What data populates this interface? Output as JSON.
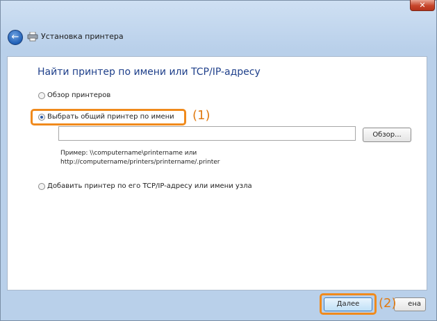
{
  "window": {
    "close_glyph": "✕",
    "title": "Установка принтера"
  },
  "page": {
    "heading": "Найти принтер по имени или TCP/IP-адресу"
  },
  "options": [
    {
      "label": "Обзор принтеров",
      "checked": false
    },
    {
      "label": "Выбрать общий принтер по имени",
      "checked": true
    },
    {
      "label": "Добавить принтер по его TCP/IP-адресу или имени узла",
      "checked": false
    }
  ],
  "name_field": {
    "value": ""
  },
  "browse_button": {
    "label": "Обзор..."
  },
  "example": {
    "line1": "Пример: \\\\computername\\printername или",
    "line2": "http://computername/printers/printername/.printer"
  },
  "callouts": {
    "one": "(1)",
    "two": "(2)"
  },
  "buttons": {
    "next": "Далее",
    "cancel_visible": "ена"
  },
  "colors": {
    "accent_highlight": "#f08a1c",
    "heading": "#1e3f8a"
  },
  "icons": {
    "back": "back-arrow-icon",
    "printer": "printer-icon",
    "close": "close-icon"
  }
}
